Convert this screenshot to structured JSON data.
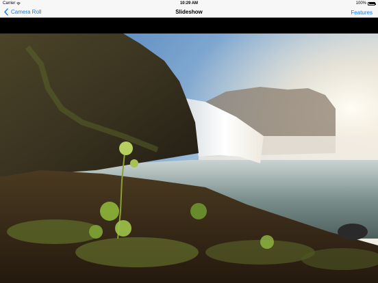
{
  "status_bar": {
    "carrier": "Carrier",
    "time": "10:29 AM",
    "battery_percent": "100%"
  },
  "nav": {
    "back_label": "Camera Roll",
    "title": "Slideshow",
    "features_label": "Features"
  },
  "photo": {
    "subject": "waterfall landscape"
  },
  "colors": {
    "accent": "#0a7aff",
    "bar_bg": "#f7f7f7"
  }
}
